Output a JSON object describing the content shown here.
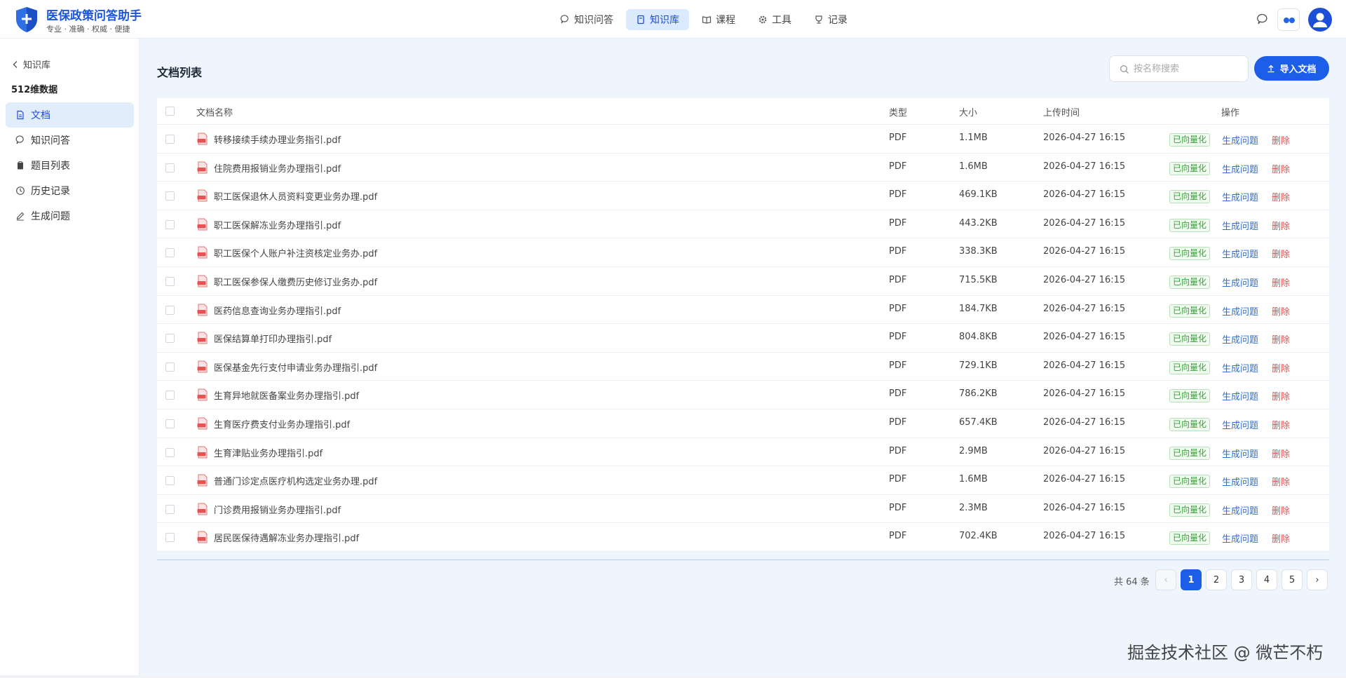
{
  "header": {
    "title": "医保政策问答助手",
    "subtitle": "专业 · 准确 · 权威 · 便捷",
    "nav": [
      {
        "label": "知识问答",
        "icon": "chat-icon",
        "active": false
      },
      {
        "label": "知识库",
        "icon": "book-icon",
        "active": true
      },
      {
        "label": "课程",
        "icon": "open-book-icon",
        "active": false
      },
      {
        "label": "工具",
        "icon": "gear-icon",
        "active": false
      },
      {
        "label": "记录",
        "icon": "trophy-icon",
        "active": false
      }
    ]
  },
  "sidebar": {
    "back_label": "知识库",
    "kb_name": "512维数据",
    "items": [
      {
        "label": "文档",
        "icon": "document-icon",
        "active": true
      },
      {
        "label": "知识问答",
        "icon": "chat-icon",
        "active": false
      },
      {
        "label": "题目列表",
        "icon": "clipboard-icon",
        "active": false
      },
      {
        "label": "历史记录",
        "icon": "clock-icon",
        "active": false
      },
      {
        "label": "生成问题",
        "icon": "pen-icon",
        "active": false
      }
    ]
  },
  "main": {
    "title": "文档列表",
    "search_placeholder": "按名称搜索",
    "import_label": "导入文档"
  },
  "table": {
    "columns": [
      "文档名称",
      "类型",
      "大小",
      "上传时间",
      "操作"
    ],
    "status_label": "已向量化",
    "generate_label": "生成问题",
    "delete_label": "删除",
    "rows": [
      {
        "name": "转移接续手续办理业务指引.pdf",
        "type": "PDF",
        "size": "1.1MB",
        "time": "2026-04-27 16:15"
      },
      {
        "name": "住院费用报销业务办理指引.pdf",
        "type": "PDF",
        "size": "1.6MB",
        "time": "2026-04-27 16:15"
      },
      {
        "name": "职工医保退休人员资料变更业务办理.pdf",
        "type": "PDF",
        "size": "469.1KB",
        "time": "2026-04-27 16:15"
      },
      {
        "name": "职工医保解冻业务办理指引.pdf",
        "type": "PDF",
        "size": "443.2KB",
        "time": "2026-04-27 16:15"
      },
      {
        "name": "职工医保个人账户补注资核定业务办.pdf",
        "type": "PDF",
        "size": "338.3KB",
        "time": "2026-04-27 16:15"
      },
      {
        "name": "职工医保参保人缴费历史修订业务办.pdf",
        "type": "PDF",
        "size": "715.5KB",
        "time": "2026-04-27 16:15"
      },
      {
        "name": "医药信息查询业务办理指引.pdf",
        "type": "PDF",
        "size": "184.7KB",
        "time": "2026-04-27 16:15"
      },
      {
        "name": "医保结算单打印办理指引.pdf",
        "type": "PDF",
        "size": "804.8KB",
        "time": "2026-04-27 16:15"
      },
      {
        "name": "医保基金先行支付申请业务办理指引.pdf",
        "type": "PDF",
        "size": "729.1KB",
        "time": "2026-04-27 16:15"
      },
      {
        "name": "生育异地就医备案业务办理指引.pdf",
        "type": "PDF",
        "size": "786.2KB",
        "time": "2026-04-27 16:15"
      },
      {
        "name": "生育医疗费支付业务办理指引.pdf",
        "type": "PDF",
        "size": "657.4KB",
        "time": "2026-04-27 16:15"
      },
      {
        "name": "生育津贴业务办理指引.pdf",
        "type": "PDF",
        "size": "2.9MB",
        "time": "2026-04-27 16:15"
      },
      {
        "name": "普通门诊定点医疗机构选定业务办理.pdf",
        "type": "PDF",
        "size": "1.6MB",
        "time": "2026-04-27 16:15"
      },
      {
        "name": "门诊费用报销业务办理指引.pdf",
        "type": "PDF",
        "size": "2.3MB",
        "time": "2026-04-27 16:15"
      },
      {
        "name": "居民医保待遇解冻业务办理指引.pdf",
        "type": "PDF",
        "size": "702.4KB",
        "time": "2026-04-27 16:15"
      }
    ]
  },
  "pagination": {
    "total": "共 64 条",
    "prev": "‹",
    "next": "›",
    "pages": [
      "1",
      "2",
      "3",
      "4",
      "5"
    ],
    "current": "1"
  },
  "watermark": "掘金技术社区 @ 微芒不朽",
  "colors": {
    "primary": "#1d5ee8",
    "status_green": "#3aa13a",
    "delete_red": "#e05252",
    "background": "#eef5fc"
  }
}
